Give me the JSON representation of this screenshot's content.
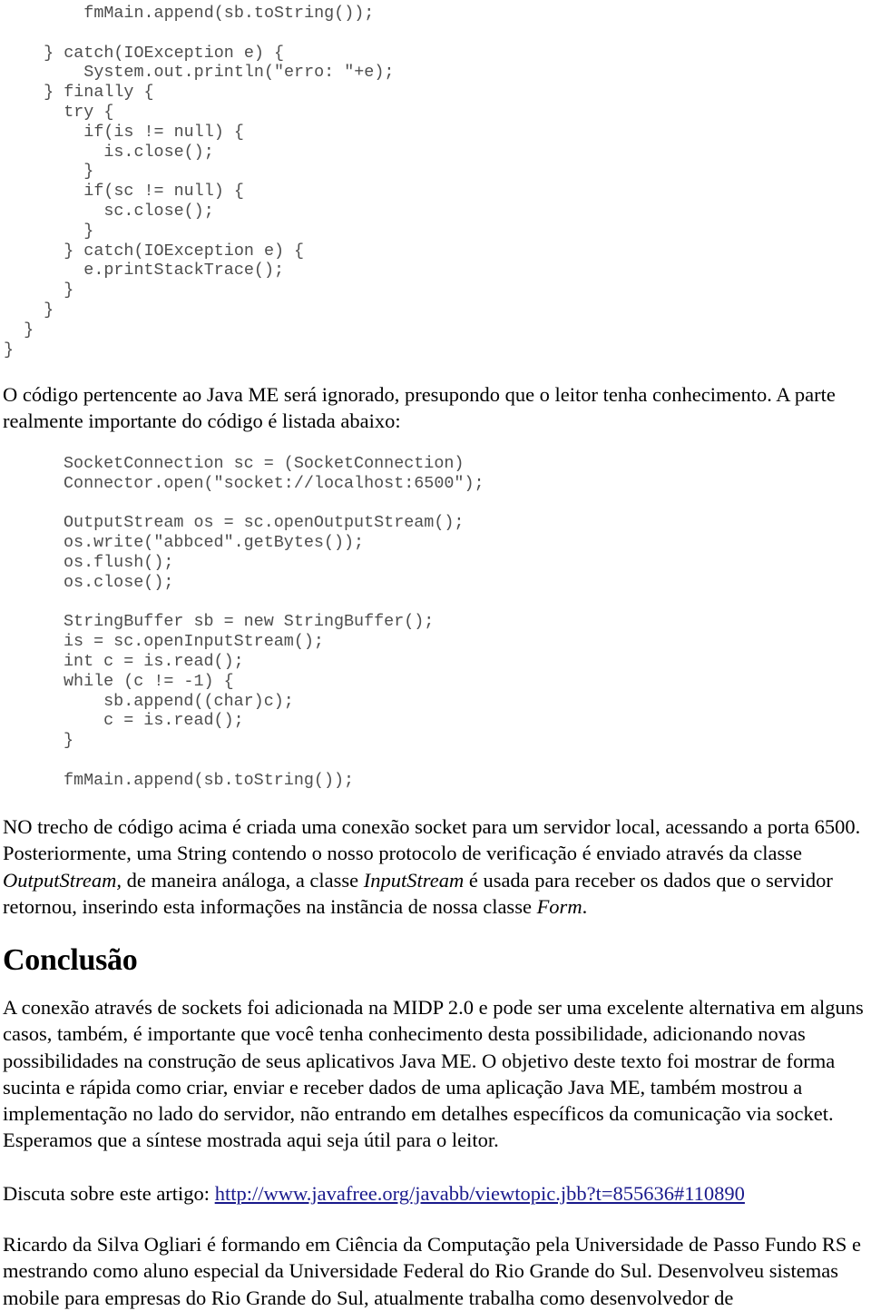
{
  "document": {
    "language": "pt-BR",
    "code_block_1": "        fmMain.append(sb.toString());\n\n    } catch(IOException e) {\n        System.out.println(\"erro: \"+e);\n    } finally {\n      try {\n        if(is != null) {\n          is.close();\n        }\n        if(sc != null) {\n          sc.close();\n        }\n      } catch(IOException e) {\n        e.printStackTrace();\n      }\n    }\n  }\n}",
    "paragraph_intro": "O código pertencente ao Java ME será ignorado, presupondo que o leitor tenha conhecimento. A parte realmente importante do código é listada abaixo:",
    "code_block_2": "SocketConnection sc = (SocketConnection)\nConnector.open(\"socket://localhost:6500\");\n\nOutputStream os = sc.openOutputStream();\nos.write(\"abbced\".getBytes());\nos.flush();\nos.close();\n\nStringBuffer sb = new StringBuffer();\nis = sc.openInputStream();\nint c = is.read();\nwhile (c != -1) {\n    sb.append((char)c);\n    c = is.read();\n}\n\nfmMain.append(sb.toString());",
    "paragraph_explain": {
      "part1": "NO trecho de código acima é criada uma conexão socket para um servidor local, acessando a porta 6500. Posteriormente, uma String contendo o nosso protocolo de verificação é enviado através da classe ",
      "italic1": "OutputStream,",
      "part2": " de maneira análoga, a classe ",
      "italic2": "InputStream",
      "part3": " é usada para receber os dados que o servidor retornou, inserindo esta informações na instãncia de nossa classe ",
      "italic3": "Form",
      "part4": "."
    },
    "heading_conclusao": "Conclusão",
    "paragraph_conclusion": "A conexão através de sockets foi adicionada na MIDP 2.0 e pode ser uma excelente alternativa em alguns casos, também, é importante que você tenha conhecimento desta possibilidade, adicionando novas possibilidades na construção de seus aplicativos Java ME. O objetivo deste texto foi mostrar de forma sucinta e rápida como criar, enviar e receber dados de uma aplicação Java ME, também mostrou a implementação no lado do servidor, não entrando em detalhes específicos da comunicação via socket. Esperamos que a síntese mostrada aqui seja útil para o leitor.",
    "discuss_label": "Discuta sobre este artigo: ",
    "discuss_link_text": "http://www.javafree.org/javabb/viewtopic.jbb?t=855636#110890",
    "paragraph_bio": "Ricardo da Silva Ogliari é formando em Ciência da Computação pela Universidade de Passo Fundo RS e mestrando como aluno especial da Universidade Federal do Rio Grande do Sul. Desenvolveu sistemas mobile para empresas do Rio Grande do Sul, atualmente trabalha como desenvolvedor de",
    "colors": {
      "code_text": "#4d4d4d",
      "body_text": "#000000",
      "link": "#1a1a8c",
      "background": "#ffffff"
    }
  }
}
